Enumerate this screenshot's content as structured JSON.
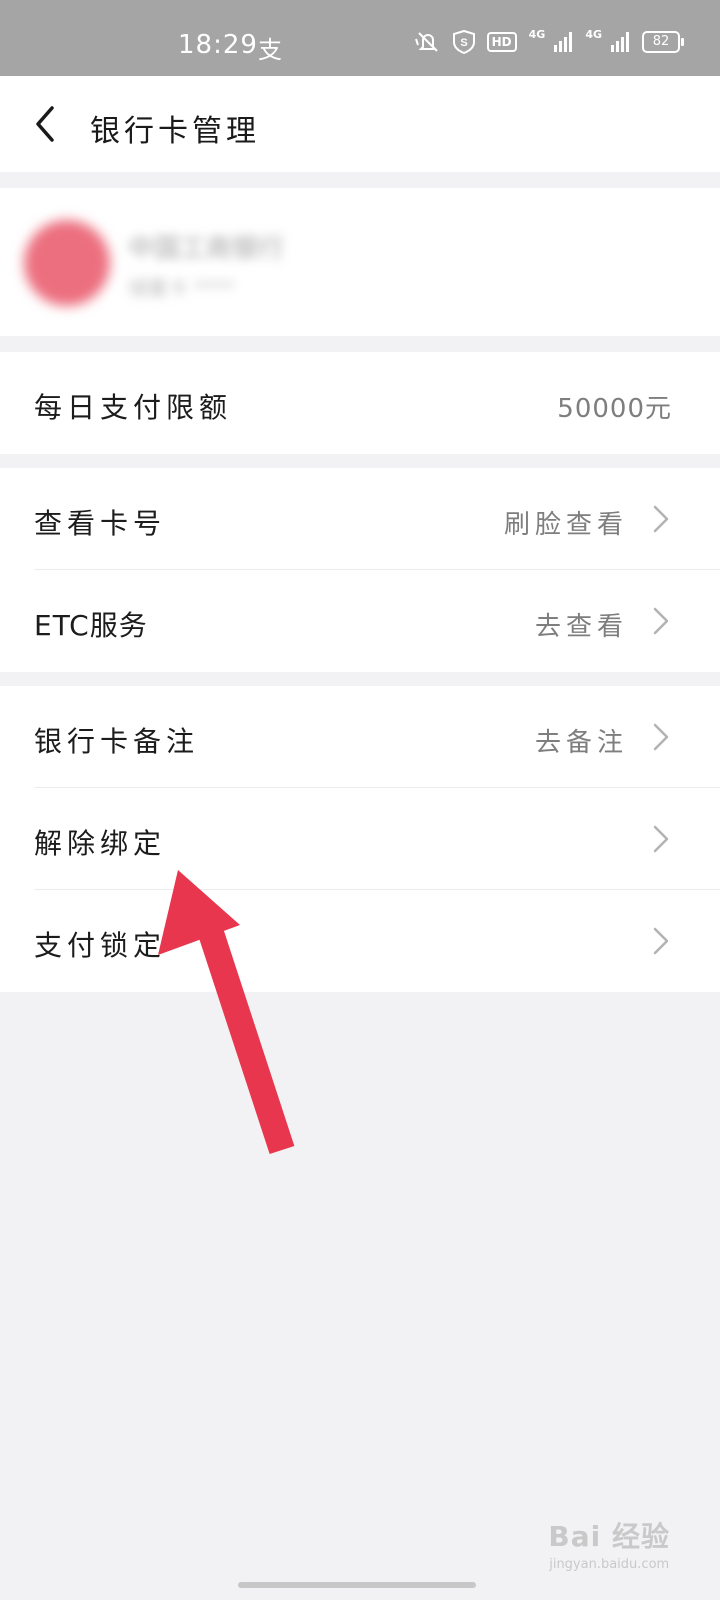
{
  "status_bar": {
    "time": "18:29",
    "app_glyph": "支",
    "hd": "HD",
    "network_1": "4G",
    "network_2": "4G",
    "battery": "82",
    "icons": [
      "mute-bell-icon",
      "vpn-shield-icon",
      "signal-icon",
      "signal-icon",
      "battery-icon"
    ]
  },
  "header": {
    "title": "银行卡管理",
    "back_icon": "chevron-left-icon"
  },
  "bank_card": {
    "name": "中国工商银行",
    "detail": "储蓄卡 ****"
  },
  "limit_row": {
    "label": "每日支付限额",
    "value": "50000元"
  },
  "group_1": [
    {
      "label": "查看卡号",
      "value": "刷脸查看"
    },
    {
      "label": "ETC服务",
      "value": "去查看"
    }
  ],
  "group_2": [
    {
      "label": "银行卡备注",
      "value": "去备注"
    },
    {
      "label": "解除绑定",
      "value": ""
    },
    {
      "label": "支付锁定",
      "value": ""
    }
  ],
  "annotation": {
    "color": "#e8364e"
  },
  "watermark": {
    "main": "Bai 经验",
    "sub": "jingyan.baidu.com"
  },
  "colors": {
    "status_bar": "#a5a5a5",
    "background": "#f2f1f3",
    "text": "#1c1c1c",
    "secondary_text": "#7e7e7e"
  }
}
